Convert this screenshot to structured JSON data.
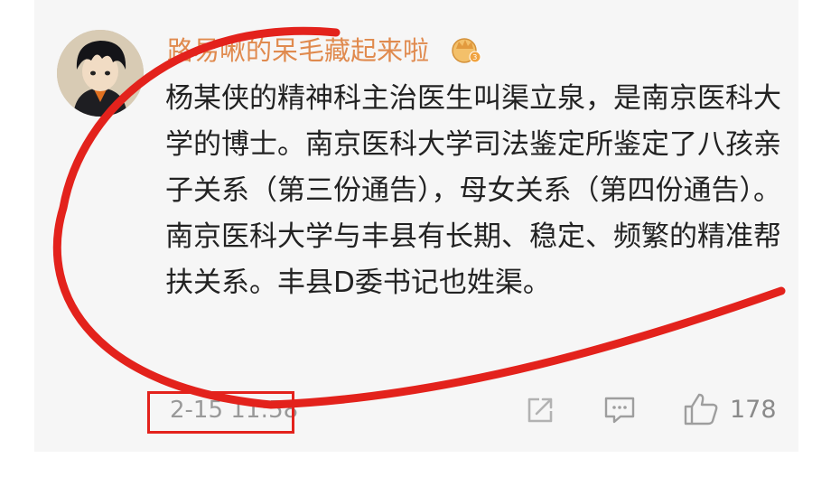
{
  "comment": {
    "username": "路易啾的呆毛藏起来啦",
    "badge_icon": "crown-badge-icon",
    "text": "杨某侠的精神科主治医生叫渠立泉，是南京医科大学的博士。南京医科大学司法鉴定所鉴定了八孩亲子关系（第三份通告），母女关系（第四份通告）。南京医科大学与丰县有长期、稳定、频繁的精准帮扶关系。丰县D委书记也姓渠。",
    "timestamp": "2-15 11:58"
  },
  "actions": {
    "share_icon": "share-icon",
    "comment_icon": "comment-icon",
    "like_icon": "thumbs-up-icon",
    "like_count": "178"
  },
  "colors": {
    "username": "#e08a4e",
    "annotation": "#e3221c"
  }
}
